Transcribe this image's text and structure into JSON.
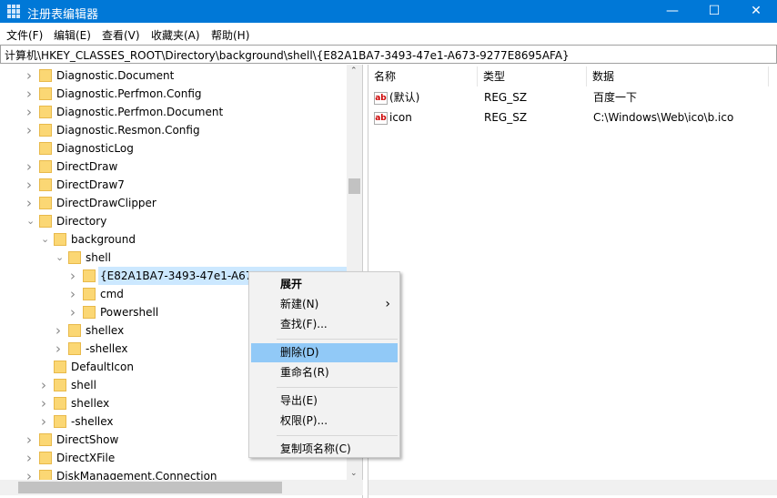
{
  "window": {
    "title": "注册表编辑器",
    "minimize": "—",
    "maximize": "☐",
    "close": "✕"
  },
  "menu": [
    "文件(F)",
    "编辑(E)",
    "查看(V)",
    "收藏夹(A)",
    "帮助(H)"
  ],
  "address": "计算机\\HKEY_CLASSES_ROOT\\Directory\\background\\shell\\{E82A1BA7-3493-47e1-A673-9277E8695AFA}",
  "tree": [
    {
      "label": "Diagnostic.Document",
      "level": 0,
      "state": "collapsed"
    },
    {
      "label": "Diagnostic.Perfmon.Config",
      "level": 0,
      "state": "collapsed"
    },
    {
      "label": "Diagnostic.Perfmon.Document",
      "level": 0,
      "state": "collapsed"
    },
    {
      "label": "Diagnostic.Resmon.Config",
      "level": 0,
      "state": "collapsed"
    },
    {
      "label": "DiagnosticLog",
      "level": 0,
      "state": "leaf"
    },
    {
      "label": "DirectDraw",
      "level": 0,
      "state": "collapsed"
    },
    {
      "label": "DirectDraw7",
      "level": 0,
      "state": "collapsed"
    },
    {
      "label": "DirectDrawClipper",
      "level": 0,
      "state": "collapsed"
    },
    {
      "label": "Directory",
      "level": 0,
      "state": "expanded"
    },
    {
      "label": "background",
      "level": 1,
      "state": "expanded"
    },
    {
      "label": "shell",
      "level": 2,
      "state": "expanded"
    },
    {
      "label": "{E82A1BA7-3493-47e1-A673-9277E8695AFA}",
      "level": 3,
      "state": "collapsed",
      "selected": true
    },
    {
      "label": "cmd",
      "level": 3,
      "state": "collapsed"
    },
    {
      "label": "Powershell",
      "level": 3,
      "state": "collapsed"
    },
    {
      "label": "shellex",
      "level": 2,
      "state": "collapsed"
    },
    {
      "label": "-shellex",
      "level": 2,
      "state": "collapsed"
    },
    {
      "label": "DefaultIcon",
      "level": 1,
      "state": "leaf"
    },
    {
      "label": "shell",
      "level": 1,
      "state": "collapsed"
    },
    {
      "label": "shellex",
      "level": 1,
      "state": "collapsed"
    },
    {
      "label": "-shellex",
      "level": 1,
      "state": "collapsed"
    },
    {
      "label": "DirectShow",
      "level": 0,
      "state": "collapsed"
    },
    {
      "label": "DirectXFile",
      "level": 0,
      "state": "collapsed"
    },
    {
      "label": "DiskManagement.Connection",
      "level": 0,
      "state": "collapsed"
    }
  ],
  "columns": {
    "name": "名称",
    "type": "类型",
    "data": "数据"
  },
  "values": [
    {
      "name": "(默认)",
      "type": "REG_SZ",
      "data": "百度一下",
      "icon": "ab"
    },
    {
      "name": "icon",
      "type": "REG_SZ",
      "data": "C:\\Windows\\Web\\ico\\b.ico",
      "icon": "ab"
    }
  ],
  "context_menu": [
    {
      "label": "展开",
      "bold": true
    },
    {
      "label": "新建(N)",
      "submenu": true
    },
    {
      "label": "查找(F)..."
    },
    {
      "sep": true
    },
    {
      "label": "删除(D)",
      "highlighted": true
    },
    {
      "label": "重命名(R)"
    },
    {
      "sep": true
    },
    {
      "label": "导出(E)"
    },
    {
      "label": "权限(P)..."
    },
    {
      "sep": true
    },
    {
      "label": "复制项名称(C)"
    }
  ]
}
